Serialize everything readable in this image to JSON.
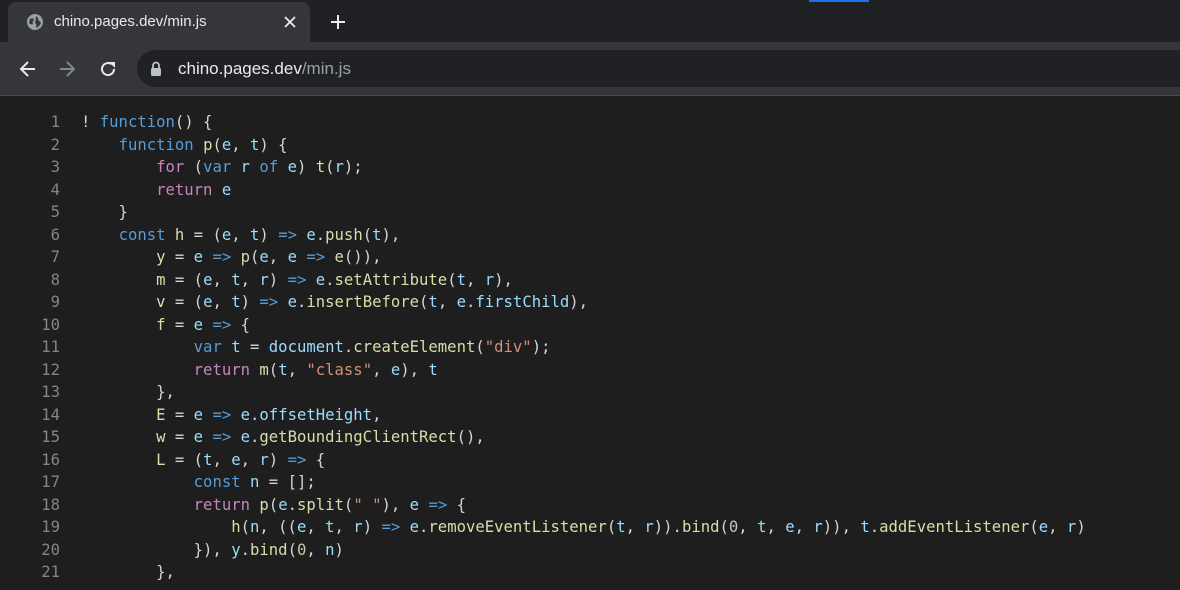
{
  "browser": {
    "tab": {
      "title": "chino.pages.dev/min.js",
      "favicon": "globe-icon",
      "close_icon": "close-icon"
    },
    "new_tab_icon": "plus-icon",
    "nav": {
      "back_icon": "back-arrow-icon",
      "forward_icon": "forward-arrow-icon",
      "reload_icon": "reload-icon"
    },
    "address": {
      "domain": "chino.pages.dev",
      "path": "/min.js",
      "security_icon": "lock-icon"
    },
    "accent_color": "#1a73e8"
  },
  "code": {
    "lines": [
      {
        "n": "1",
        "tokens": [
          [
            "! ",
            "plain"
          ],
          [
            "function",
            "kw"
          ],
          [
            "() {",
            "plain"
          ]
        ]
      },
      {
        "n": "2",
        "tokens": [
          [
            "    ",
            "plain"
          ],
          [
            "function",
            "kw"
          ],
          [
            " ",
            "plain"
          ],
          [
            "p",
            "fn"
          ],
          [
            "(",
            "plain"
          ],
          [
            "e",
            "var"
          ],
          [
            ", ",
            "plain"
          ],
          [
            "t",
            "var"
          ],
          [
            ") {",
            "plain"
          ]
        ]
      },
      {
        "n": "3",
        "tokens": [
          [
            "        ",
            "plain"
          ],
          [
            "for",
            "ctl"
          ],
          [
            " (",
            "plain"
          ],
          [
            "var",
            "kw"
          ],
          [
            " ",
            "plain"
          ],
          [
            "r",
            "var"
          ],
          [
            " ",
            "plain"
          ],
          [
            "of",
            "kw"
          ],
          [
            " ",
            "plain"
          ],
          [
            "e",
            "var"
          ],
          [
            ") ",
            "plain"
          ],
          [
            "t",
            "fn"
          ],
          [
            "(",
            "plain"
          ],
          [
            "r",
            "var"
          ],
          [
            ");",
            "plain"
          ]
        ]
      },
      {
        "n": "4",
        "tokens": [
          [
            "        ",
            "plain"
          ],
          [
            "return",
            "ctl"
          ],
          [
            " ",
            "plain"
          ],
          [
            "e",
            "var"
          ]
        ]
      },
      {
        "n": "5",
        "tokens": [
          [
            "    }",
            "plain"
          ]
        ]
      },
      {
        "n": "6",
        "tokens": [
          [
            "    ",
            "plain"
          ],
          [
            "const",
            "kw"
          ],
          [
            " ",
            "plain"
          ],
          [
            "h",
            "fn"
          ],
          [
            " = (",
            "plain"
          ],
          [
            "e",
            "var"
          ],
          [
            ", ",
            "plain"
          ],
          [
            "t",
            "var"
          ],
          [
            ") ",
            "plain"
          ],
          [
            "=>",
            "kw"
          ],
          [
            " ",
            "plain"
          ],
          [
            "e",
            "var"
          ],
          [
            ".",
            "plain"
          ],
          [
            "push",
            "fn"
          ],
          [
            "(",
            "plain"
          ],
          [
            "t",
            "var"
          ],
          [
            "),",
            "plain"
          ]
        ]
      },
      {
        "n": "7",
        "tokens": [
          [
            "        ",
            "plain"
          ],
          [
            "y",
            "fn"
          ],
          [
            " = ",
            "plain"
          ],
          [
            "e",
            "var"
          ],
          [
            " ",
            "plain"
          ],
          [
            "=>",
            "kw"
          ],
          [
            " ",
            "plain"
          ],
          [
            "p",
            "fn"
          ],
          [
            "(",
            "plain"
          ],
          [
            "e",
            "var"
          ],
          [
            ", ",
            "plain"
          ],
          [
            "e",
            "var"
          ],
          [
            " ",
            "plain"
          ],
          [
            "=>",
            "kw"
          ],
          [
            " ",
            "plain"
          ],
          [
            "e",
            "fn"
          ],
          [
            "()),",
            "plain"
          ]
        ]
      },
      {
        "n": "8",
        "tokens": [
          [
            "        ",
            "plain"
          ],
          [
            "m",
            "fn"
          ],
          [
            " = (",
            "plain"
          ],
          [
            "e",
            "var"
          ],
          [
            ", ",
            "plain"
          ],
          [
            "t",
            "var"
          ],
          [
            ", ",
            "plain"
          ],
          [
            "r",
            "var"
          ],
          [
            ") ",
            "plain"
          ],
          [
            "=>",
            "kw"
          ],
          [
            " ",
            "plain"
          ],
          [
            "e",
            "var"
          ],
          [
            ".",
            "plain"
          ],
          [
            "setAttribute",
            "fn"
          ],
          [
            "(",
            "plain"
          ],
          [
            "t",
            "var"
          ],
          [
            ", ",
            "plain"
          ],
          [
            "r",
            "var"
          ],
          [
            "),",
            "plain"
          ]
        ]
      },
      {
        "n": "9",
        "tokens": [
          [
            "        ",
            "plain"
          ],
          [
            "v",
            "fn"
          ],
          [
            " = (",
            "plain"
          ],
          [
            "e",
            "var"
          ],
          [
            ", ",
            "plain"
          ],
          [
            "t",
            "var"
          ],
          [
            ") ",
            "plain"
          ],
          [
            "=>",
            "kw"
          ],
          [
            " ",
            "plain"
          ],
          [
            "e",
            "var"
          ],
          [
            ".",
            "plain"
          ],
          [
            "insertBefore",
            "fn"
          ],
          [
            "(",
            "plain"
          ],
          [
            "t",
            "var"
          ],
          [
            ", ",
            "plain"
          ],
          [
            "e",
            "var"
          ],
          [
            ".",
            "plain"
          ],
          [
            "firstChild",
            "var"
          ],
          [
            "),",
            "plain"
          ]
        ]
      },
      {
        "n": "10",
        "tokens": [
          [
            "        ",
            "plain"
          ],
          [
            "f",
            "fn"
          ],
          [
            " = ",
            "plain"
          ],
          [
            "e",
            "var"
          ],
          [
            " ",
            "plain"
          ],
          [
            "=>",
            "kw"
          ],
          [
            " {",
            "plain"
          ]
        ]
      },
      {
        "n": "11",
        "tokens": [
          [
            "            ",
            "plain"
          ],
          [
            "var",
            "kw"
          ],
          [
            " ",
            "plain"
          ],
          [
            "t",
            "var"
          ],
          [
            " = ",
            "plain"
          ],
          [
            "document",
            "var"
          ],
          [
            ".",
            "plain"
          ],
          [
            "createElement",
            "fn"
          ],
          [
            "(",
            "plain"
          ],
          [
            "\"div\"",
            "str"
          ],
          [
            ");",
            "plain"
          ]
        ]
      },
      {
        "n": "12",
        "tokens": [
          [
            "            ",
            "plain"
          ],
          [
            "return",
            "ctl"
          ],
          [
            " ",
            "plain"
          ],
          [
            "m",
            "fn"
          ],
          [
            "(",
            "plain"
          ],
          [
            "t",
            "var"
          ],
          [
            ", ",
            "plain"
          ],
          [
            "\"class\"",
            "str"
          ],
          [
            ", ",
            "plain"
          ],
          [
            "e",
            "var"
          ],
          [
            "), ",
            "plain"
          ],
          [
            "t",
            "var"
          ]
        ]
      },
      {
        "n": "13",
        "tokens": [
          [
            "        },",
            "plain"
          ]
        ]
      },
      {
        "n": "14",
        "tokens": [
          [
            "        ",
            "plain"
          ],
          [
            "E",
            "fn"
          ],
          [
            " = ",
            "plain"
          ],
          [
            "e",
            "var"
          ],
          [
            " ",
            "plain"
          ],
          [
            "=>",
            "kw"
          ],
          [
            " ",
            "plain"
          ],
          [
            "e",
            "var"
          ],
          [
            ".",
            "plain"
          ],
          [
            "offsetHeight",
            "var"
          ],
          [
            ",",
            "plain"
          ]
        ]
      },
      {
        "n": "15",
        "tokens": [
          [
            "        ",
            "plain"
          ],
          [
            "w",
            "fn"
          ],
          [
            " = ",
            "plain"
          ],
          [
            "e",
            "var"
          ],
          [
            " ",
            "plain"
          ],
          [
            "=>",
            "kw"
          ],
          [
            " ",
            "plain"
          ],
          [
            "e",
            "var"
          ],
          [
            ".",
            "plain"
          ],
          [
            "getBoundingClientRect",
            "fn"
          ],
          [
            "(),",
            "plain"
          ]
        ]
      },
      {
        "n": "16",
        "tokens": [
          [
            "        ",
            "plain"
          ],
          [
            "L",
            "fn"
          ],
          [
            " = (",
            "plain"
          ],
          [
            "t",
            "var"
          ],
          [
            ", ",
            "plain"
          ],
          [
            "e",
            "var"
          ],
          [
            ", ",
            "plain"
          ],
          [
            "r",
            "var"
          ],
          [
            ") ",
            "plain"
          ],
          [
            "=>",
            "kw"
          ],
          [
            " {",
            "plain"
          ]
        ]
      },
      {
        "n": "17",
        "tokens": [
          [
            "            ",
            "plain"
          ],
          [
            "const",
            "kw"
          ],
          [
            " ",
            "plain"
          ],
          [
            "n",
            "var"
          ],
          [
            " = [];",
            "plain"
          ]
        ]
      },
      {
        "n": "18",
        "tokens": [
          [
            "            ",
            "plain"
          ],
          [
            "return",
            "ctl"
          ],
          [
            " ",
            "plain"
          ],
          [
            "p",
            "fn"
          ],
          [
            "(",
            "plain"
          ],
          [
            "e",
            "var"
          ],
          [
            ".",
            "plain"
          ],
          [
            "split",
            "fn"
          ],
          [
            "(",
            "plain"
          ],
          [
            "\" \"",
            "str"
          ],
          [
            "), ",
            "plain"
          ],
          [
            "e",
            "var"
          ],
          [
            " ",
            "plain"
          ],
          [
            "=>",
            "kw"
          ],
          [
            " {",
            "plain"
          ]
        ]
      },
      {
        "n": "19",
        "tokens": [
          [
            "                ",
            "plain"
          ],
          [
            "h",
            "fn"
          ],
          [
            "(",
            "plain"
          ],
          [
            "n",
            "var"
          ],
          [
            ", ((",
            "plain"
          ],
          [
            "e",
            "var"
          ],
          [
            ", ",
            "plain"
          ],
          [
            "t",
            "var"
          ],
          [
            ", ",
            "plain"
          ],
          [
            "r",
            "var"
          ],
          [
            ") ",
            "plain"
          ],
          [
            "=>",
            "kw"
          ],
          [
            " ",
            "plain"
          ],
          [
            "e",
            "var"
          ],
          [
            ".",
            "plain"
          ],
          [
            "removeEventListener",
            "fn"
          ],
          [
            "(",
            "plain"
          ],
          [
            "t",
            "var"
          ],
          [
            ", ",
            "plain"
          ],
          [
            "r",
            "var"
          ],
          [
            ")).",
            "plain"
          ],
          [
            "bind",
            "fn"
          ],
          [
            "(",
            "plain"
          ],
          [
            "0",
            "num"
          ],
          [
            ", ",
            "plain"
          ],
          [
            "t",
            "var"
          ],
          [
            ", ",
            "plain"
          ],
          [
            "e",
            "var"
          ],
          [
            ", ",
            "plain"
          ],
          [
            "r",
            "var"
          ],
          [
            ")), ",
            "plain"
          ],
          [
            "t",
            "var"
          ],
          [
            ".",
            "plain"
          ],
          [
            "addEventListener",
            "fn"
          ],
          [
            "(",
            "plain"
          ],
          [
            "e",
            "var"
          ],
          [
            ", ",
            "plain"
          ],
          [
            "r",
            "var"
          ],
          [
            ")",
            "plain"
          ]
        ]
      },
      {
        "n": "20",
        "tokens": [
          [
            "            }), ",
            "plain"
          ],
          [
            "y",
            "var"
          ],
          [
            ".",
            "plain"
          ],
          [
            "bind",
            "fn"
          ],
          [
            "(",
            "plain"
          ],
          [
            "0",
            "num"
          ],
          [
            ", ",
            "plain"
          ],
          [
            "n",
            "var"
          ],
          [
            ")",
            "plain"
          ]
        ]
      },
      {
        "n": "21",
        "tokens": [
          [
            "        },",
            "plain"
          ]
        ]
      }
    ]
  }
}
